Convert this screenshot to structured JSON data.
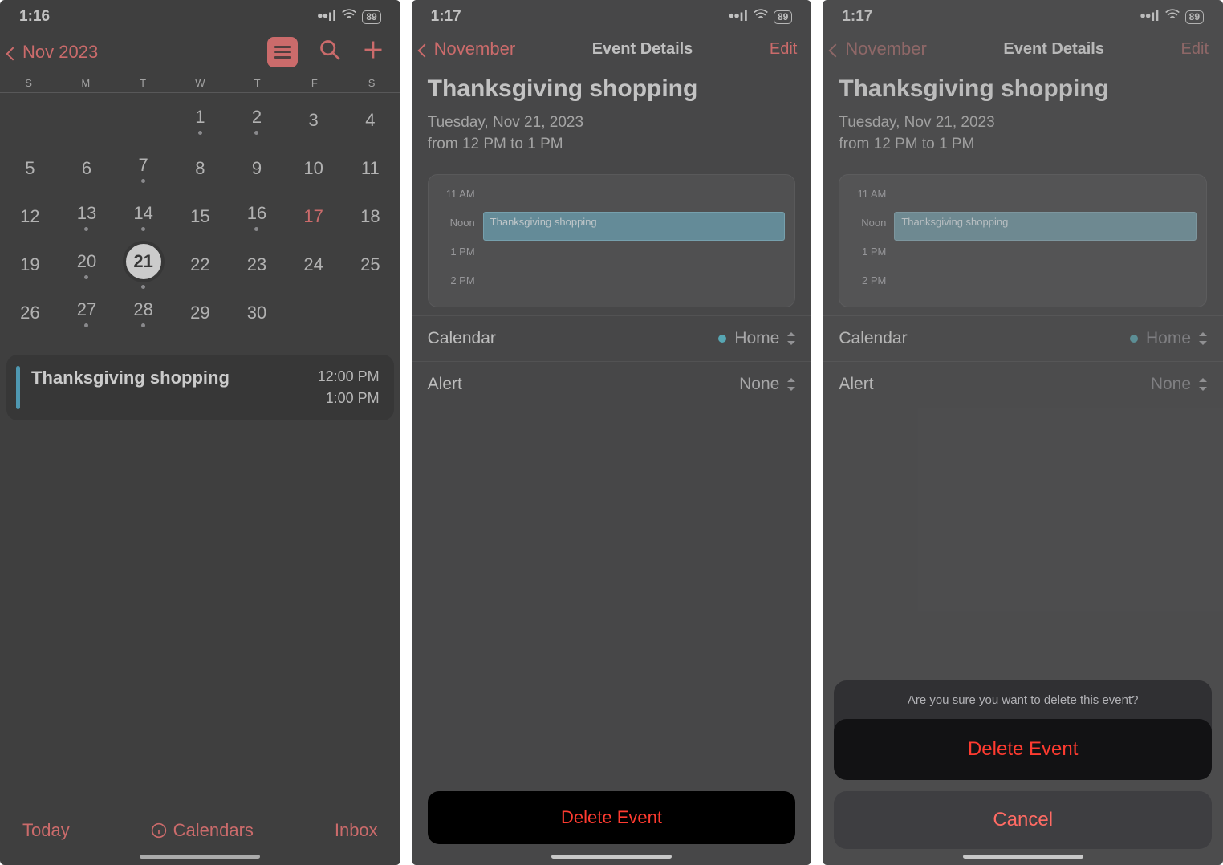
{
  "status": {
    "battery": "89",
    "time1": "1:16",
    "time2": "1:17",
    "time3": "1:17"
  },
  "p1": {
    "back_label": "Nov 2023",
    "weekdays": [
      "S",
      "M",
      "T",
      "W",
      "T",
      "F",
      "S"
    ],
    "weeks": [
      [
        "",
        "",
        "",
        "1",
        "2",
        "3",
        "4"
      ],
      [
        "5",
        "6",
        "7",
        "8",
        "9",
        "10",
        "11"
      ],
      [
        "12",
        "13",
        "14",
        "15",
        "16",
        "17",
        "18"
      ],
      [
        "19",
        "20",
        "21",
        "22",
        "23",
        "24",
        "25"
      ],
      [
        "26",
        "27",
        "28",
        "29",
        "30",
        "",
        ""
      ]
    ],
    "selected": "21",
    "event": {
      "title": "Thanksgiving shopping",
      "start": "12:00 PM",
      "end": "1:00 PM"
    },
    "tab": {
      "today": "Today",
      "calendars": "Calendars",
      "inbox": "Inbox"
    }
  },
  "p2": {
    "back_label": "November",
    "center_title": "Event Details",
    "edit_label": "Edit",
    "title": "Thanksgiving shopping",
    "date_line": "Tuesday, Nov 21, 2023",
    "time_line": "from 12 PM to 1 PM",
    "hours": [
      "11 AM",
      "Noon",
      "1 PM",
      "2 PM"
    ],
    "mini_label": "Thanksgiving shopping",
    "row_calendar": "Calendar",
    "row_calendar_val": "Home",
    "row_alert": "Alert",
    "row_alert_val": "None",
    "delete": "Delete Event"
  },
  "p3": {
    "back_label": "November",
    "center_title": "Event Details",
    "edit_label": "Edit",
    "title": "Thanksgiving shopping",
    "date_line": "Tuesday, Nov 21, 2023",
    "time_line": "from 12 PM to 1 PM",
    "hours": [
      "11 AM",
      "Noon",
      "1 PM",
      "2 PM"
    ],
    "mini_label": "Thanksgiving shopping",
    "row_calendar": "Calendar",
    "row_calendar_val": "Home",
    "row_alert": "Alert",
    "row_alert_val": "None",
    "sheet": {
      "question": "Are you sure you want to delete this event?",
      "delete": "Delete Event",
      "cancel": "Cancel"
    }
  }
}
